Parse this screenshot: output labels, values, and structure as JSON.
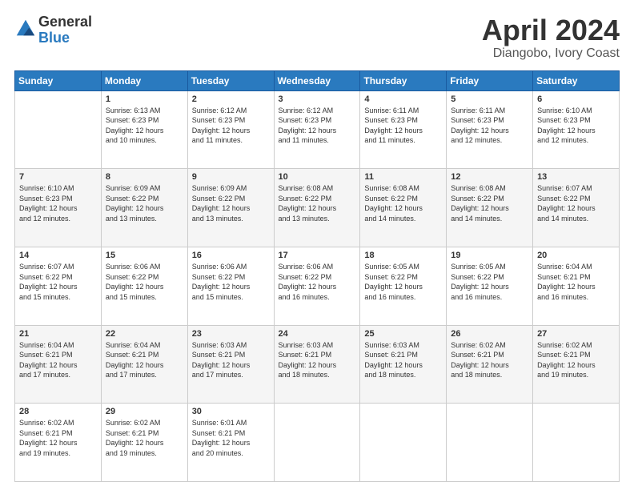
{
  "logo": {
    "general": "General",
    "blue": "Blue"
  },
  "title": {
    "month": "April 2024",
    "location": "Diangobo, Ivory Coast"
  },
  "days_of_week": [
    "Sunday",
    "Monday",
    "Tuesday",
    "Wednesday",
    "Thursday",
    "Friday",
    "Saturday"
  ],
  "weeks": [
    [
      {
        "day": "",
        "info": ""
      },
      {
        "day": "1",
        "info": "Sunrise: 6:13 AM\nSunset: 6:23 PM\nDaylight: 12 hours\nand 10 minutes."
      },
      {
        "day": "2",
        "info": "Sunrise: 6:12 AM\nSunset: 6:23 PM\nDaylight: 12 hours\nand 11 minutes."
      },
      {
        "day": "3",
        "info": "Sunrise: 6:12 AM\nSunset: 6:23 PM\nDaylight: 12 hours\nand 11 minutes."
      },
      {
        "day": "4",
        "info": "Sunrise: 6:11 AM\nSunset: 6:23 PM\nDaylight: 12 hours\nand 11 minutes."
      },
      {
        "day": "5",
        "info": "Sunrise: 6:11 AM\nSunset: 6:23 PM\nDaylight: 12 hours\nand 12 minutes."
      },
      {
        "day": "6",
        "info": "Sunrise: 6:10 AM\nSunset: 6:23 PM\nDaylight: 12 hours\nand 12 minutes."
      }
    ],
    [
      {
        "day": "7",
        "info": "Sunrise: 6:10 AM\nSunset: 6:23 PM\nDaylight: 12 hours\nand 12 minutes."
      },
      {
        "day": "8",
        "info": "Sunrise: 6:09 AM\nSunset: 6:22 PM\nDaylight: 12 hours\nand 13 minutes."
      },
      {
        "day": "9",
        "info": "Sunrise: 6:09 AM\nSunset: 6:22 PM\nDaylight: 12 hours\nand 13 minutes."
      },
      {
        "day": "10",
        "info": "Sunrise: 6:08 AM\nSunset: 6:22 PM\nDaylight: 12 hours\nand 13 minutes."
      },
      {
        "day": "11",
        "info": "Sunrise: 6:08 AM\nSunset: 6:22 PM\nDaylight: 12 hours\nand 14 minutes."
      },
      {
        "day": "12",
        "info": "Sunrise: 6:08 AM\nSunset: 6:22 PM\nDaylight: 12 hours\nand 14 minutes."
      },
      {
        "day": "13",
        "info": "Sunrise: 6:07 AM\nSunset: 6:22 PM\nDaylight: 12 hours\nand 14 minutes."
      }
    ],
    [
      {
        "day": "14",
        "info": "Sunrise: 6:07 AM\nSunset: 6:22 PM\nDaylight: 12 hours\nand 15 minutes."
      },
      {
        "day": "15",
        "info": "Sunrise: 6:06 AM\nSunset: 6:22 PM\nDaylight: 12 hours\nand 15 minutes."
      },
      {
        "day": "16",
        "info": "Sunrise: 6:06 AM\nSunset: 6:22 PM\nDaylight: 12 hours\nand 15 minutes."
      },
      {
        "day": "17",
        "info": "Sunrise: 6:06 AM\nSunset: 6:22 PM\nDaylight: 12 hours\nand 16 minutes."
      },
      {
        "day": "18",
        "info": "Sunrise: 6:05 AM\nSunset: 6:22 PM\nDaylight: 12 hours\nand 16 minutes."
      },
      {
        "day": "19",
        "info": "Sunrise: 6:05 AM\nSunset: 6:22 PM\nDaylight: 12 hours\nand 16 minutes."
      },
      {
        "day": "20",
        "info": "Sunrise: 6:04 AM\nSunset: 6:21 PM\nDaylight: 12 hours\nand 16 minutes."
      }
    ],
    [
      {
        "day": "21",
        "info": "Sunrise: 6:04 AM\nSunset: 6:21 PM\nDaylight: 12 hours\nand 17 minutes."
      },
      {
        "day": "22",
        "info": "Sunrise: 6:04 AM\nSunset: 6:21 PM\nDaylight: 12 hours\nand 17 minutes."
      },
      {
        "day": "23",
        "info": "Sunrise: 6:03 AM\nSunset: 6:21 PM\nDaylight: 12 hours\nand 17 minutes."
      },
      {
        "day": "24",
        "info": "Sunrise: 6:03 AM\nSunset: 6:21 PM\nDaylight: 12 hours\nand 18 minutes."
      },
      {
        "day": "25",
        "info": "Sunrise: 6:03 AM\nSunset: 6:21 PM\nDaylight: 12 hours\nand 18 minutes."
      },
      {
        "day": "26",
        "info": "Sunrise: 6:02 AM\nSunset: 6:21 PM\nDaylight: 12 hours\nand 18 minutes."
      },
      {
        "day": "27",
        "info": "Sunrise: 6:02 AM\nSunset: 6:21 PM\nDaylight: 12 hours\nand 19 minutes."
      }
    ],
    [
      {
        "day": "28",
        "info": "Sunrise: 6:02 AM\nSunset: 6:21 PM\nDaylight: 12 hours\nand 19 minutes."
      },
      {
        "day": "29",
        "info": "Sunrise: 6:02 AM\nSunset: 6:21 PM\nDaylight: 12 hours\nand 19 minutes."
      },
      {
        "day": "30",
        "info": "Sunrise: 6:01 AM\nSunset: 6:21 PM\nDaylight: 12 hours\nand 20 minutes."
      },
      {
        "day": "",
        "info": ""
      },
      {
        "day": "",
        "info": ""
      },
      {
        "day": "",
        "info": ""
      },
      {
        "day": "",
        "info": ""
      }
    ]
  ]
}
